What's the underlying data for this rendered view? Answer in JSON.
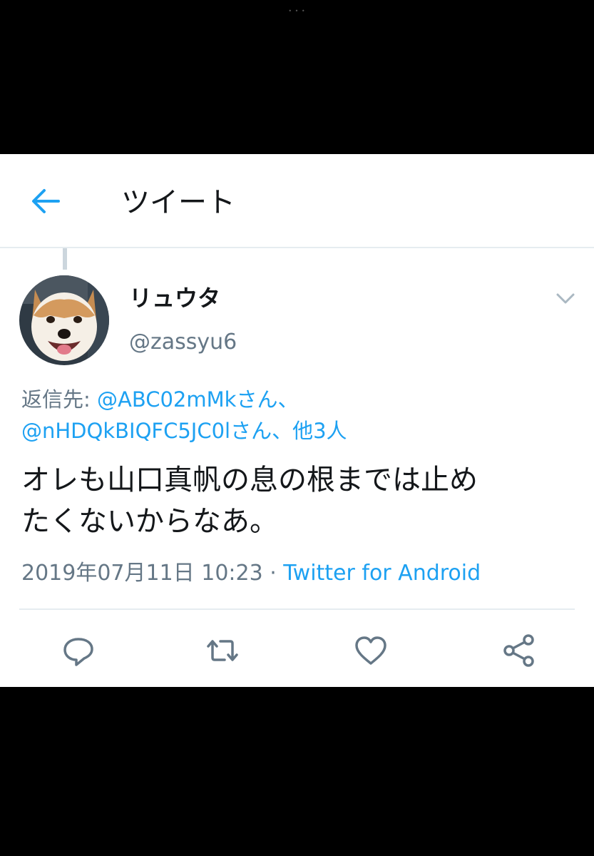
{
  "screen": {
    "status_dots": "• • •"
  },
  "header": {
    "title": "ツイート",
    "back_icon": "arrow-left-icon"
  },
  "tweet": {
    "display_name": "リュウタ",
    "handle": "@zassyu6",
    "avatar_icon": "dog-avatar",
    "reply_prefix": "返信先: ",
    "reply_mention_1": "@ABC02mMkさん、",
    "reply_mention_2": "@nHDQkBIQFC5JC0lさん、他3人",
    "text_line_1": "オレも山口真帆の息の根までは止め",
    "text_line_2": "たくないからなあ。",
    "timestamp": "2019年07月11日 10:23",
    "separator": " · ",
    "source": "Twitter for Android"
  },
  "actions": {
    "reply_icon": "comment-icon",
    "retweet_icon": "retweet-icon",
    "like_icon": "heart-icon",
    "share_icon": "share-icon"
  },
  "colors": {
    "accent": "#1da1f2",
    "secondary_text": "#657786",
    "divider": "#e6ecf0",
    "background": "#000000"
  }
}
